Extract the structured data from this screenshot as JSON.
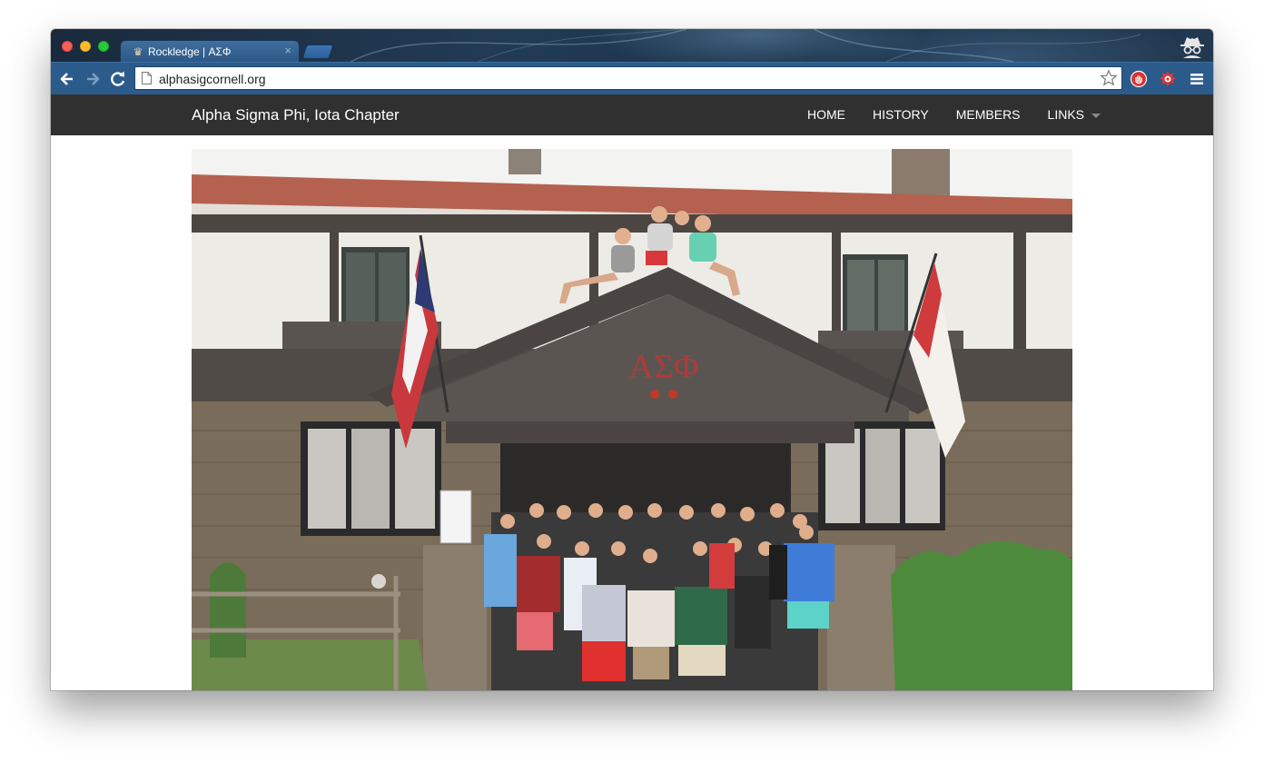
{
  "browser": {
    "tab_title": "Rockledge | ΑΣΦ",
    "tab_close": "×",
    "url": "alphasigcornell.org"
  },
  "site": {
    "brand": "Alpha Sigma Phi, Iota Chapter",
    "nav": {
      "home": "HOME",
      "history": "HISTORY",
      "members": "MEMBERS",
      "links": "LINKS"
    },
    "photo_letters": "ΑΣΦ"
  },
  "colors": {
    "navbar_bg": "#303030",
    "toolbar_bg": "#2b5b8b",
    "roof": "#b5614f",
    "stucco": "#ecebe6",
    "timber": "#4a4542",
    "stone": "#7a6c5a",
    "letters": "#b03a38"
  },
  "icons": {
    "back": "back-arrow-icon",
    "forward": "forward-arrow-icon",
    "reload": "reload-icon",
    "page": "page-icon",
    "bookmark": "star-icon",
    "ext1": "stop-icon",
    "ext2": "bug-icon",
    "menu": "hamburger-icon",
    "incognito": "incognito-icon"
  }
}
